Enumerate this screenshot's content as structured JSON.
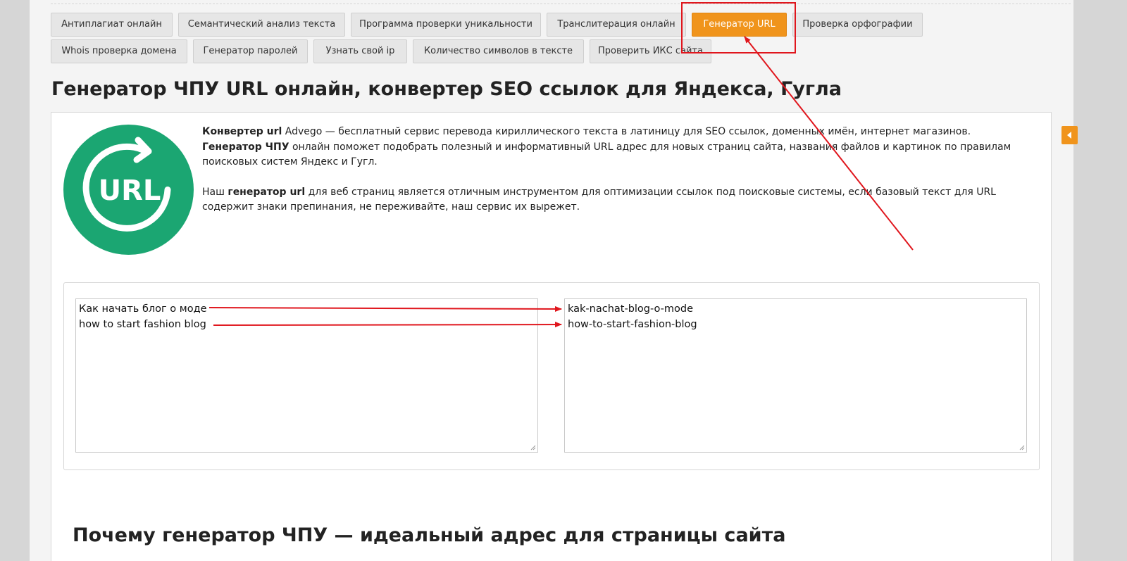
{
  "tools": [
    {
      "label": "Антиплагиат онлайн"
    },
    {
      "label": "Семантический анализ текста"
    },
    {
      "label": "Программа проверки уникальности"
    },
    {
      "label": "Транслитерация онлайн"
    },
    {
      "label": "Генератор URL"
    },
    {
      "label": "Проверка орфографии"
    },
    {
      "label": "Whois проверка домена"
    },
    {
      "label": "Генератор паролей"
    },
    {
      "label": "Узнать свой ip"
    },
    {
      "label": "Количество символов в тексте"
    },
    {
      "label": "Проверить ИКС сайта"
    }
  ],
  "active_tool": "Генератор URL",
  "page_title": "Генератор ЧПУ URL онлайн, конвертер SEO ссылок для Яндекса, Гугла",
  "logo_text": "URL",
  "intro": {
    "p1_bold": "Конвертер url",
    "p1_text": " Advego — бесплатный сервис перевода кириллического текста в латиницу для SEO ссылок, доменных имён, интернет магазинов.",
    "p2_bold": "Генератор ЧПУ",
    "p2_text": " онлайн поможет подобрать полезный и информативный URL адрес для новых страниц сайта, названия файлов и картинок по правилам поисковых систем Яндекс и Гугл.",
    "p3_lead": "Наш ",
    "p3_bold": "генератор url",
    "p3_text": " для веб страниц является отличным инструментом для оптимизации ссылок под поисковые системы, если базовый текст для URL содержит знаки препинания, не переживайте, наш сервис их вырежет."
  },
  "converter": {
    "input_lines": [
      "Как начать блог о моде",
      "how to start fashion blog"
    ],
    "output_lines": [
      "kak-nachat-blog-o-mode",
      "how-to-start-fashion-blog"
    ]
  },
  "section_title": "Почему генератор ЧПУ — идеальный адрес для страницы сайта",
  "colors": {
    "accent": "#f0941c",
    "logo_green": "#1ba672",
    "annotation_red": "#e0161d"
  }
}
